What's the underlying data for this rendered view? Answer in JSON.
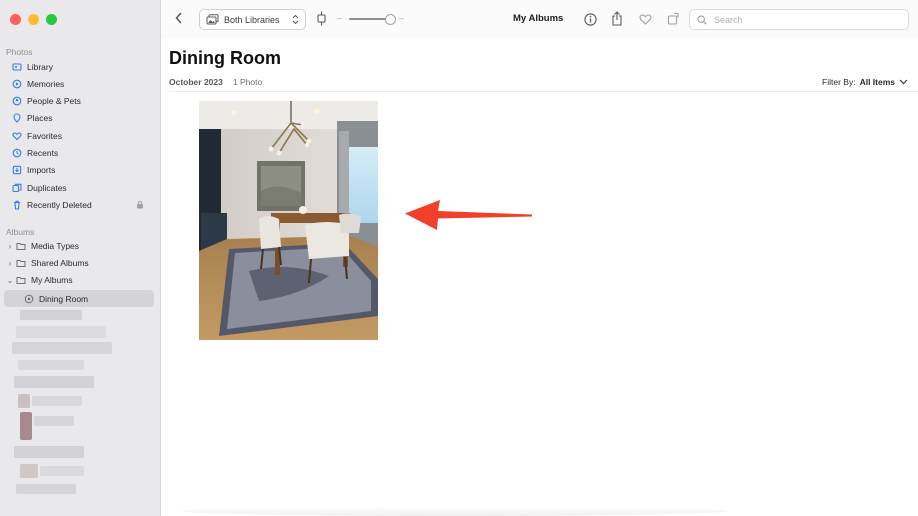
{
  "colors": {
    "close": "#ff5f57",
    "minimize": "#febc2e",
    "zoom": "#28c840",
    "accent": "#2f7cf6",
    "arrow": "#f0402a"
  },
  "sidebar": {
    "photos_header": "Photos",
    "items": [
      {
        "label": "Library",
        "icon": "library-icon"
      },
      {
        "label": "Memories",
        "icon": "memories-icon"
      },
      {
        "label": "People & Pets",
        "icon": "people-icon"
      },
      {
        "label": "Places",
        "icon": "places-icon"
      },
      {
        "label": "Favorites",
        "icon": "heart-icon"
      },
      {
        "label": "Recents",
        "icon": "clock-icon"
      },
      {
        "label": "Imports",
        "icon": "import-icon"
      },
      {
        "label": "Duplicates",
        "icon": "duplicates-icon"
      },
      {
        "label": "Recently Deleted",
        "icon": "trash-icon"
      }
    ],
    "albums_header": "Albums",
    "albums": [
      {
        "label": "Media Types",
        "icon": "folder-icon"
      },
      {
        "label": "Shared Albums",
        "icon": "folder-icon"
      },
      {
        "label": "My Albums",
        "icon": "folder-icon"
      },
      {
        "label": "Dining Room",
        "icon": "album-icon"
      }
    ]
  },
  "toolbar": {
    "library_select": "Both Libraries",
    "title": "My Albums",
    "search_placeholder": "Search"
  },
  "album": {
    "title": "Dining Room",
    "date": "October 2023",
    "count": "1 Photo",
    "filter_label": "Filter By:",
    "filter_value": "All Items"
  }
}
